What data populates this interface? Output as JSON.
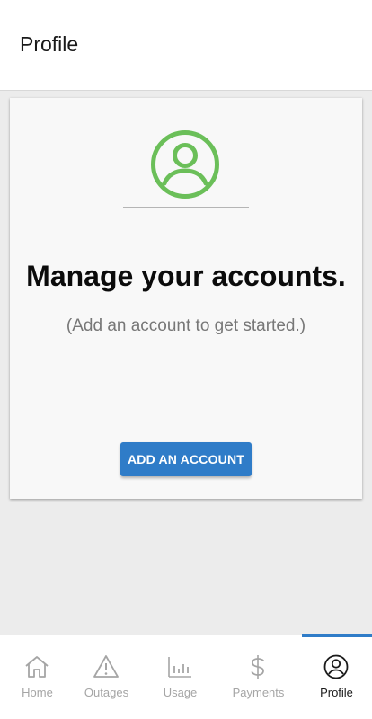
{
  "app_bar": {
    "title": "Profile"
  },
  "card": {
    "avatar_icon": "account-circle-icon",
    "headline": "Manage your accounts.",
    "subline": "(Add an account to get started.)",
    "button_label": "ADD AN ACCOUNT"
  },
  "bottom_nav": {
    "active_index": 4,
    "items": [
      {
        "label": "Home",
        "icon": "home-icon"
      },
      {
        "label": "Outages",
        "icon": "warning-icon"
      },
      {
        "label": "Usage",
        "icon": "bar-chart-icon"
      },
      {
        "label": "Payments",
        "icon": "dollar-icon"
      },
      {
        "label": "Profile",
        "icon": "account-circle-icon"
      }
    ]
  },
  "colors": {
    "accent": "#2f7cc8",
    "avatar_green": "#6bbf59",
    "inactive_nav": "#a5a5a5",
    "active_nav": "#1a1a1a"
  }
}
